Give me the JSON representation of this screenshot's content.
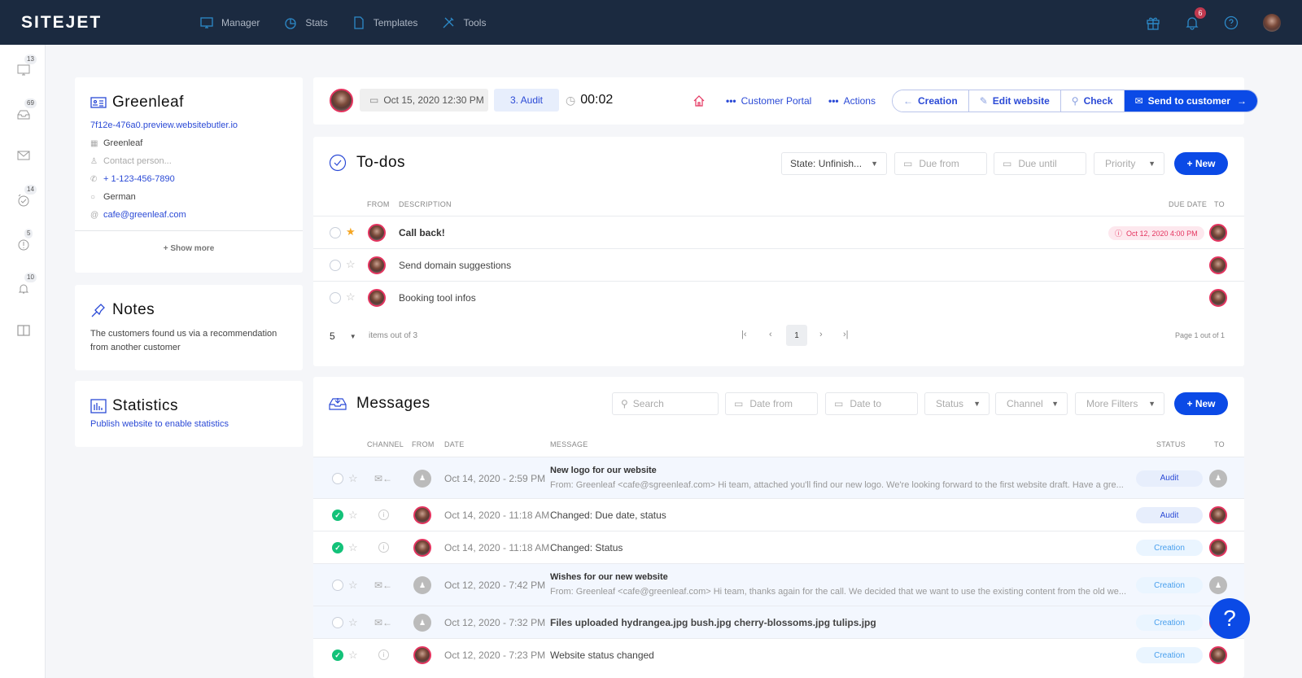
{
  "topbar": {
    "logo": "SITEJET",
    "nav": [
      {
        "label": "Manager",
        "icon": "monitor-icon"
      },
      {
        "label": "Stats",
        "icon": "pie-chart-icon"
      },
      {
        "label": "Templates",
        "icon": "file-icon"
      },
      {
        "label": "Tools",
        "icon": "tools-icon"
      }
    ],
    "notifications_count": "6"
  },
  "rail": {
    "items": [
      {
        "icon": "monitor-icon",
        "count": "13"
      },
      {
        "icon": "inbox-icon",
        "count": "69"
      },
      {
        "icon": "mail-icon",
        "count": ""
      },
      {
        "icon": "alarm-icon",
        "count": "14"
      },
      {
        "icon": "alert-icon",
        "count": "5"
      },
      {
        "icon": "bell-icon",
        "count": "10"
      },
      {
        "icon": "columns-icon",
        "count": ""
      }
    ]
  },
  "customer": {
    "name": "Greenleaf",
    "url": "7f12e-476a0.preview.websitebutler.io",
    "company": "Greenleaf",
    "contact_placeholder": "Contact person...",
    "phone": "+ 1-123-456-7890",
    "language": "German",
    "email": "cafe@greenleaf.com",
    "show_more": "+ Show more"
  },
  "notes": {
    "title": "Notes",
    "text": "The customers found us via a recommendation from another customer"
  },
  "statistics": {
    "title": "Statistics",
    "text": "Publish website to enable statistics"
  },
  "header": {
    "date": "Oct 15, 2020 12:30 PM",
    "phase": "3. Audit",
    "timer": "00:02",
    "customer_portal": "Customer Portal",
    "actions": "Actions",
    "buttons": [
      "Creation",
      "Edit website",
      "Check",
      "Send to customer"
    ]
  },
  "todos": {
    "title": "To-dos",
    "filters": {
      "state": "State: Unfinish...",
      "due_from": "Due from",
      "due_until": "Due until",
      "priority": "Priority"
    },
    "new_label": "+ New",
    "columns": {
      "from": "FROM",
      "description": "DESCRIPTION",
      "due_date": "DUE DATE",
      "to": "TO"
    },
    "rows": [
      {
        "description": "Call back!",
        "starred": true,
        "due": "Oct 12, 2020 4:00 PM",
        "bold": true
      },
      {
        "description": "Send domain suggestions",
        "starred": false,
        "due": "",
        "bold": false
      },
      {
        "description": "Booking tool infos",
        "starred": false,
        "due": "",
        "bold": false
      }
    ],
    "per_page": "5",
    "items_text": "items out of 3",
    "current_page": "1",
    "page_text": "Page 1 out of 1"
  },
  "messages": {
    "title": "Messages",
    "filters": {
      "search": "Search",
      "date_from": "Date from",
      "date_to": "Date to",
      "status": "Status",
      "channel": "Channel",
      "more": "More Filters"
    },
    "new_label": "+ New",
    "columns": {
      "channel": "CHANNEL",
      "from": "FROM",
      "date": "DATE",
      "message": "MESSAGE",
      "status": "STATUS",
      "to": "TO"
    },
    "rows": [
      {
        "done": false,
        "channel": "email",
        "from": "guest",
        "date": "Oct 14, 2020 - 2:59 PM",
        "subject": "New logo for our website",
        "preview": "From: Greenleaf <cafe@sgreenleaf.com> Hi team, attached you'll find our new logo. We're looking forward to the first website draft. Have a gre...",
        "status": "Audit",
        "to": "guest",
        "highlight": true
      },
      {
        "done": true,
        "channel": "info",
        "from": "user",
        "date": "Oct 14, 2020 - 11:18 AM",
        "subject": "Changed: Due date, status",
        "preview": "",
        "status": "Audit",
        "to": "user",
        "highlight": false
      },
      {
        "done": true,
        "channel": "info",
        "from": "user",
        "date": "Oct 14, 2020 - 11:18 AM",
        "subject": "Changed: Status",
        "preview": "",
        "status": "Creation",
        "to": "user",
        "highlight": false
      },
      {
        "done": false,
        "channel": "email",
        "from": "guest",
        "date": "Oct 12, 2020 - 7:42 PM",
        "subject": "Wishes for our new website",
        "preview": "From: Greenleaf <cafe@greenleaf.com> Hi team, thanks again for the call. We decided that we want to use the existing content from the old we...",
        "status": "Creation",
        "to": "guest",
        "highlight": true
      },
      {
        "done": false,
        "channel": "email",
        "from": "guest",
        "date": "Oct 12, 2020 - 7:32 PM",
        "subject": "Files uploaded hydrangea.jpg bush.jpg cherry-blossoms.jpg tulips.jpg",
        "preview": "",
        "status": "Creation",
        "to": "user",
        "highlight": true
      },
      {
        "done": true,
        "channel": "info",
        "from": "user",
        "date": "Oct 12, 2020 - 7:23 PM",
        "subject": "Website status changed",
        "preview": "",
        "status": "Creation",
        "to": "user",
        "highlight": false
      }
    ]
  },
  "help_label": "?"
}
